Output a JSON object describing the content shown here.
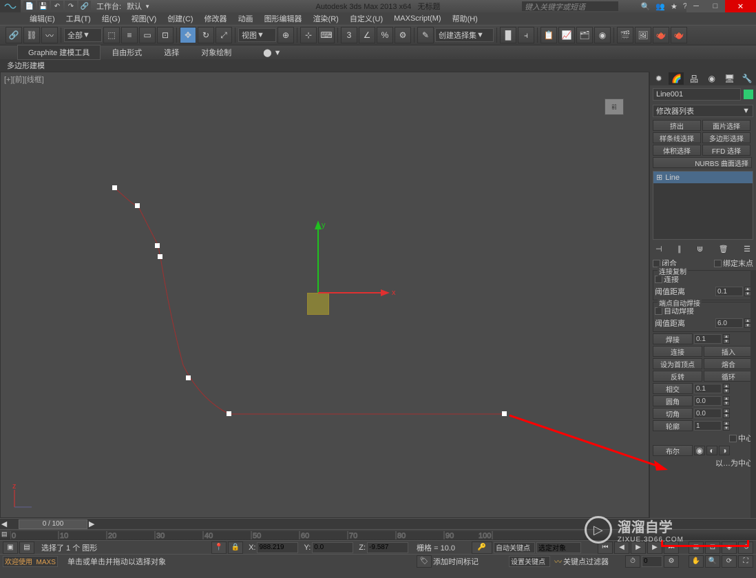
{
  "titlebar": {
    "workspace_label": "工作台:",
    "workspace_value": "默认",
    "app_title": "Autodesk 3ds Max  2013 x64",
    "doc_title": "无标题",
    "search_placeholder": "键入关键字或短语"
  },
  "menu": {
    "items": [
      "编辑(E)",
      "工具(T)",
      "组(G)",
      "视图(V)",
      "创建(C)",
      "修改器",
      "动画",
      "图形编辑器",
      "渲染(R)",
      "自定义(U)",
      "MAXScript(M)",
      "帮助(H)"
    ]
  },
  "toolbar": {
    "filter_all": "全部",
    "view_label": "视图",
    "selectionset_label": "创建选择集"
  },
  "ribbon": {
    "tabs": [
      "Graphite 建模工具",
      "自由形式",
      "选择",
      "对象绘制"
    ],
    "sub": "多边形建模"
  },
  "viewport": {
    "label": "[+][前][线框]",
    "viewcube": "前",
    "axis_x": "x",
    "axis_y": "y",
    "axis_z": "z"
  },
  "panel": {
    "obj_name": "Line001",
    "modifier_list": "修改器列表",
    "mod_buttons": [
      "挤出",
      "面片选择",
      "样条线选择",
      "多边形选择",
      "体积选择",
      "FFD 选择"
    ],
    "nurbs": "NURBS 曲面选择",
    "stack_item": "Line",
    "sec_close": "闭合",
    "sec_bind_end": "绑定末点",
    "sec_connect_copy_title": "连接复制",
    "sec_connect": "连接",
    "sec_threshold": "阈值距离",
    "threshold_val": "0.1",
    "sec_auto_weld_title": "端点自动焊接",
    "sec_auto_weld": "自动焊接",
    "sec_threshold2": "阈值距离",
    "threshold2_val": "6.0",
    "sec_weld": "焊接",
    "weld_val": "0.1",
    "sec_connect2": "连接",
    "sec_insert": "插入",
    "sec_make_first": "设为首顶点",
    "sec_fuse": "熔合",
    "sec_reverse": "反转",
    "sec_cycle": "循环",
    "sec_cross": "相交",
    "cross_val": "0.1",
    "sec_fillet": "圆角",
    "fillet_val": "0.0",
    "sec_chamfer": "切角",
    "chamfer_val": "0.0",
    "sec_outline": "轮廓",
    "outline_val": "1",
    "sec_center": "中心",
    "sec_bool": "布尔",
    "sec_mirror_center": "以…为中心"
  },
  "timeline": {
    "frame": "0 / 100"
  },
  "status": {
    "selection": "选择了 1 个 图形",
    "prompt": "单击或单击并拖动以选择对象",
    "welcome": "欢迎使用  MAXSc",
    "x_label": "X:",
    "x_val": "988.219",
    "y_label": "Y:",
    "y_val": "0.0",
    "z_label": "Z:",
    "z_val": "-9.587",
    "grid": "栅格 = 10.0",
    "autokey": "自动关键点",
    "selset": "选定对象",
    "setkey": "设置关键点",
    "keyfilter": "关键点过滤器",
    "addtime": "添加时间标记"
  },
  "watermark": {
    "main": "溜溜自学",
    "sub": "ZIXUE.3D66.COM"
  }
}
